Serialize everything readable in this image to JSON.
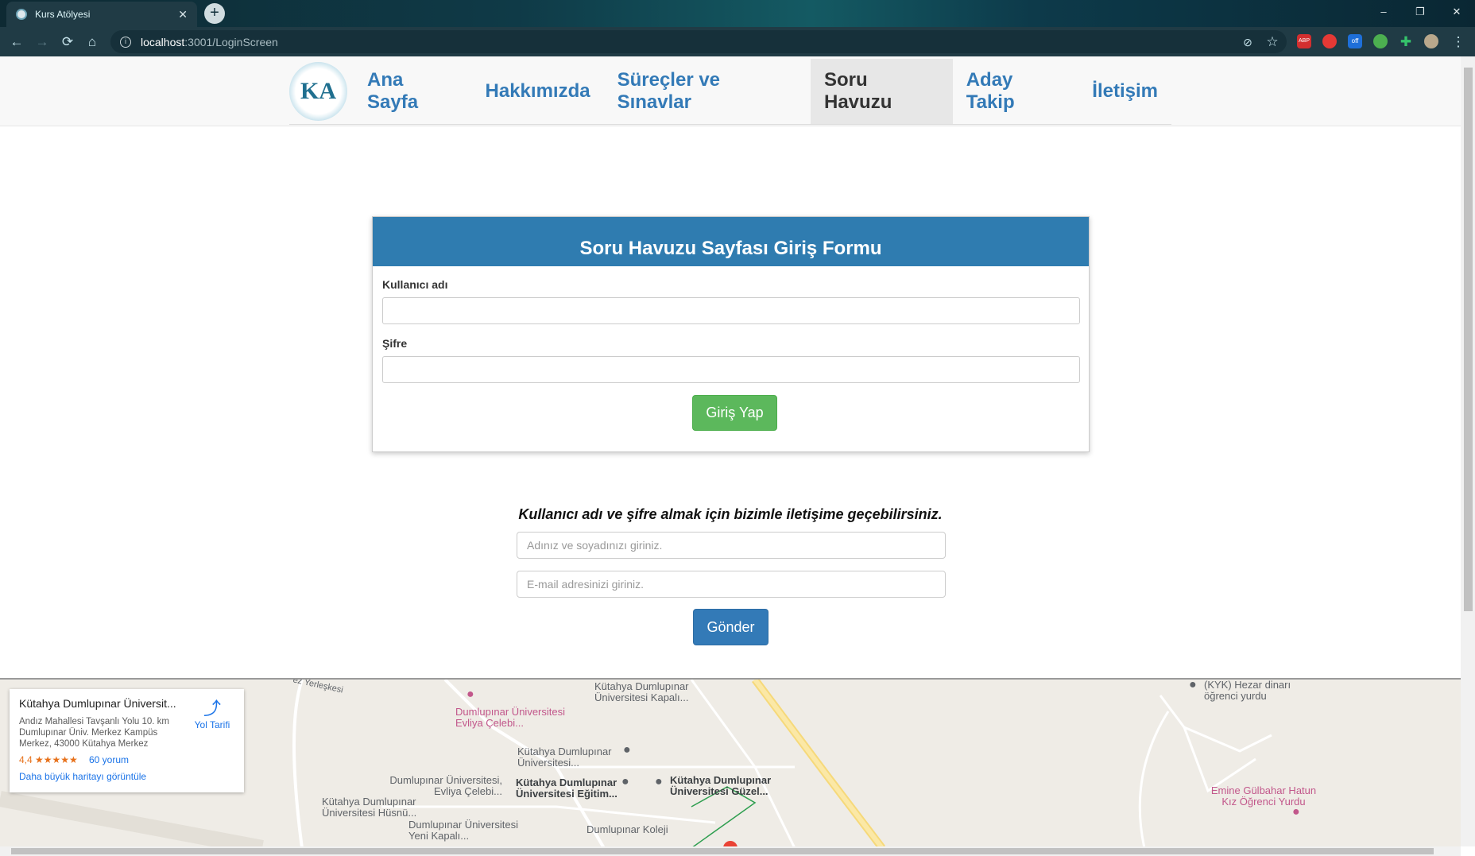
{
  "browser": {
    "tab_title": "Kurs Atölyesi",
    "new_tab": "+",
    "url_host": "localhost",
    "url_path": ":3001/LoginScreen",
    "window_controls": [
      "–",
      "❐",
      "✕"
    ],
    "extensions": [
      "ABP",
      "off"
    ]
  },
  "nav": {
    "logo_text": "KA",
    "items": [
      {
        "label": "Ana Sayfa"
      },
      {
        "label": "Hakkımızda"
      },
      {
        "label": "Süreçler ve Sınavlar"
      },
      {
        "label": "Soru Havuzu"
      },
      {
        "label": "Aday Takip"
      },
      {
        "label": "İletişim"
      }
    ],
    "active": "Soru Havuzu"
  },
  "login": {
    "title": "Soru Havuzu Sayfası Giriş Formu",
    "username_label": "Kullanıcı adı",
    "password_label": "Şifre",
    "submit_label": "Giriş Yap"
  },
  "contact": {
    "title": "Kullanıcı adı ve şifre almak için bizimle iletişime geçebilirsiniz.",
    "name_placeholder": "Adınız ve soyadınızı giriniz.",
    "email_placeholder": "E-mail adresinizi giriniz.",
    "submit_label": "Gönder"
  },
  "map": {
    "place_title": "Kütahya Dumlupınar Üniversit...",
    "address": "Andız Mahallesi Tavşanlı Yolu 10. km Dumlupınar Üniv. Merkez Kampüs Merkez, 43000 Kütahya Merkez",
    "rating": "4,4 ★★★★★",
    "reviews": "60 yorum",
    "larger_map": "Daha büyük haritayı görüntüle",
    "directions": "Yol Tarifi",
    "labels": {
      "yerleskesi": "ez Yerleşkesi",
      "kapali": "Kütahya Dumlupınar Üniversitesi Kapalı...",
      "evliya_pink": "Dumlupınar Üniversitesi Evliya Çelebi...",
      "univ1": "Kütahya Dumlupınar Üniversitesi...",
      "evliya": "Dumlupınar Üniversitesi, Evliya Çelebi...",
      "egitim": "Kütahya Dumlupınar Üniversitesi Eğitim...",
      "guzel": "Kütahya Dumlupınar Üniversitesi Güzel...",
      "husnu": "Kütahya Dumlupınar Üniversitesi Hüsnü...",
      "yeni": "Dumlupınar Üniversitesi Yeni Kapalı...",
      "koleji": "Dumlupınar Koleji",
      "kyk": "(KYK) Hezar dinarı öğrenci yurdu",
      "emine": "Emine Gülbahar Hatun Kız Öğrenci Yurdu"
    }
  }
}
